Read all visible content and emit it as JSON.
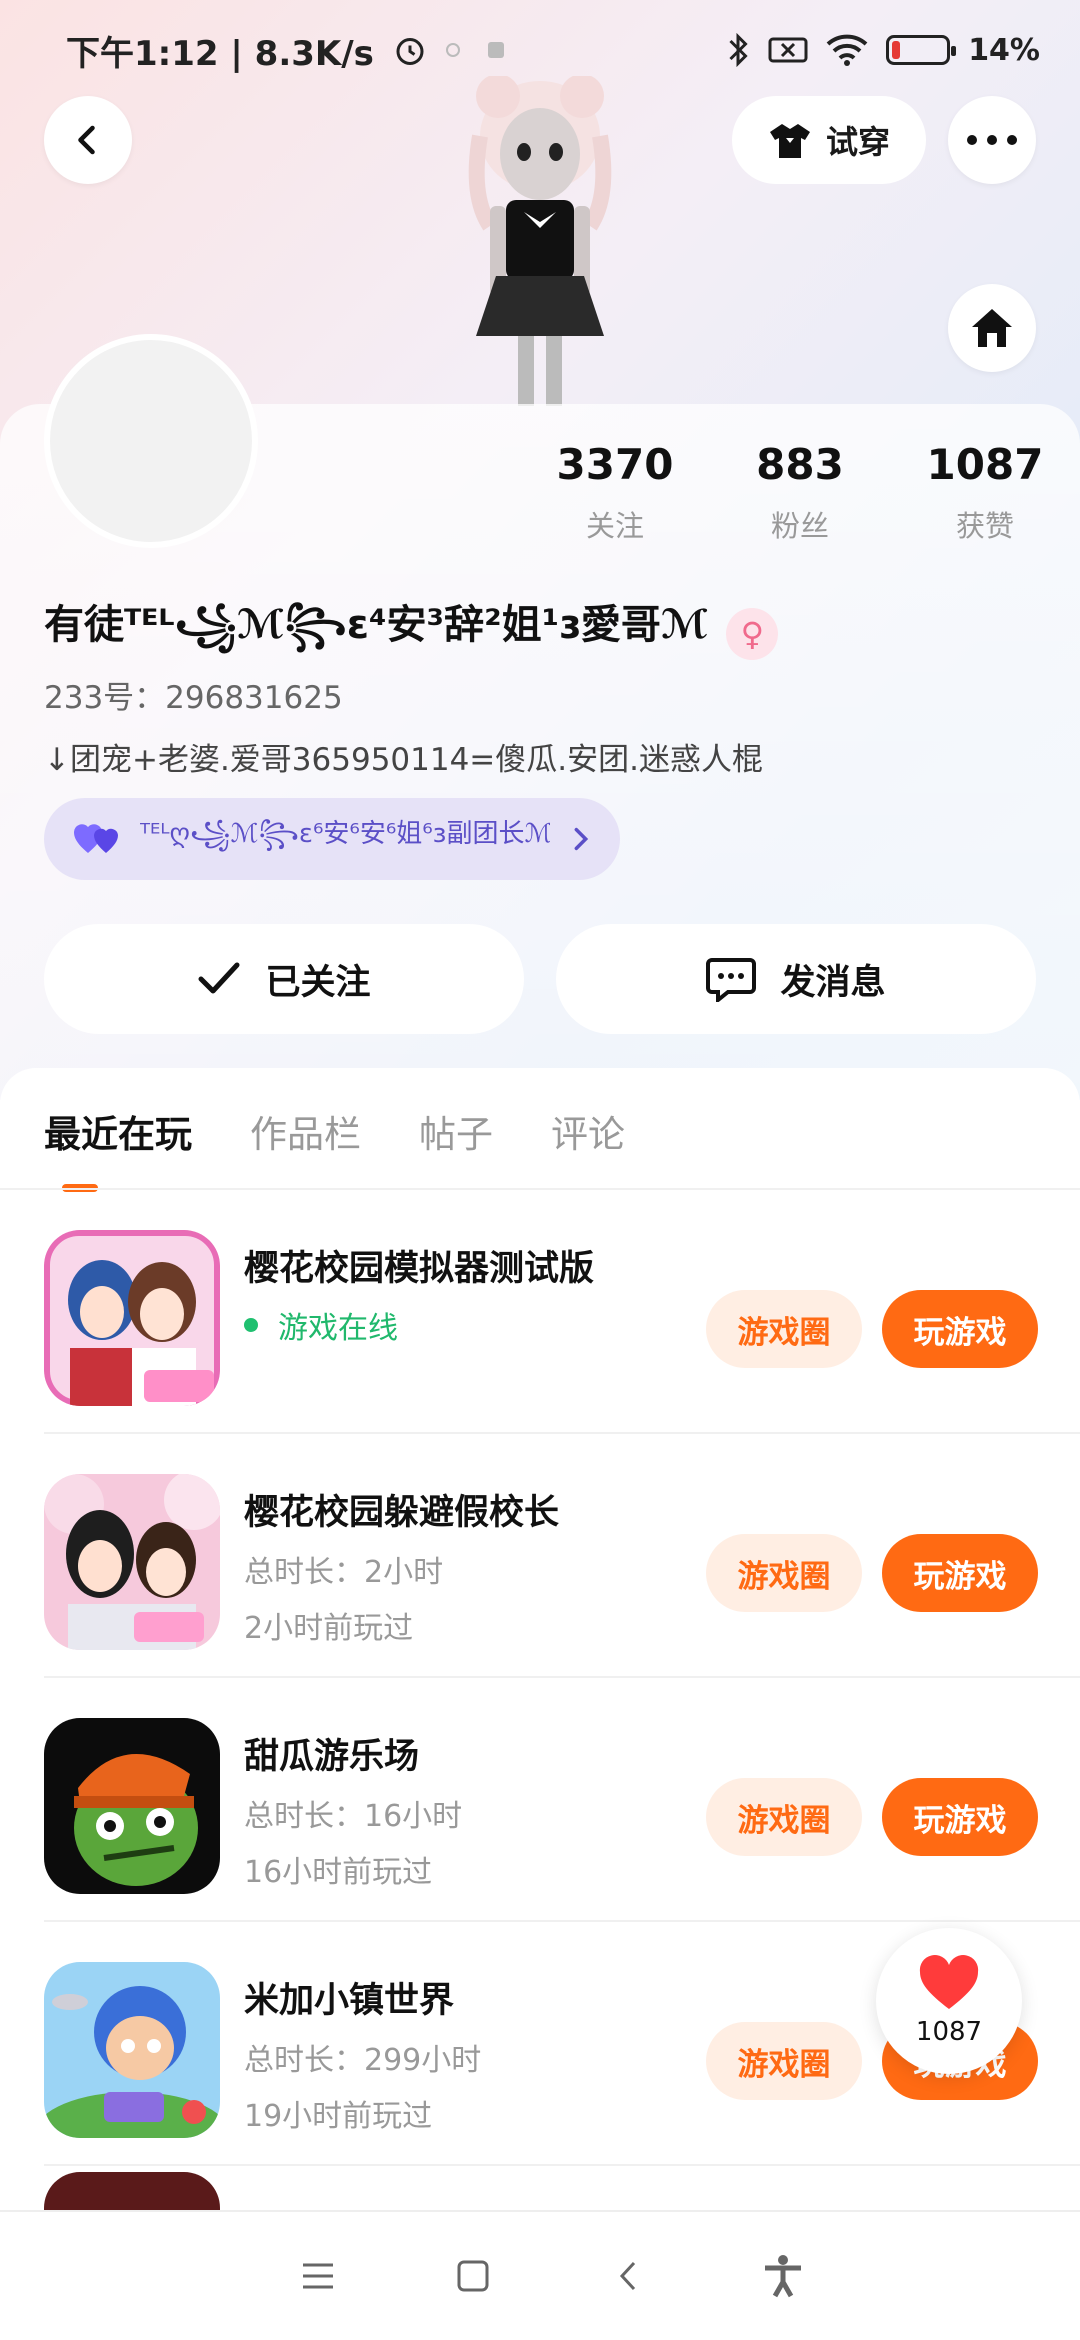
{
  "status_bar": {
    "time_speed": "下午1:12 | 8.3K/s",
    "battery": "14%",
    "battery_level": 0.14
  },
  "header": {
    "tryon_label": "试穿"
  },
  "stats": [
    {
      "num": "3370",
      "label": "关注"
    },
    {
      "num": "883",
      "label": "粉丝"
    },
    {
      "num": "1087",
      "label": "获赞"
    }
  ],
  "profile": {
    "nickname": "有徒ᵀᴱᴸ꧁ℳ꧂ɛ⁴安³辞²姐¹ɜ愛哥ℳ",
    "gender_symbol": "♀",
    "uid": "233号：296831625",
    "bio": "↓团宠+老婆.爱哥365950114=傻瓜.安团.迷惑人棍",
    "group_chip": "ᵀᴱᴸღ꧁ℳ꧂ɛ⁶安⁶安⁶姐⁶ɜ副团长ℳ"
  },
  "actions": {
    "follow_label": "已关注",
    "message_label": "发消息"
  },
  "tabs": [
    {
      "label": "最近在玩",
      "active": true
    },
    {
      "label": "作品栏",
      "active": false
    },
    {
      "label": "帖子",
      "active": false
    },
    {
      "label": "评论",
      "active": false
    }
  ],
  "games": [
    {
      "title": "樱花校园模拟器测试版",
      "status": "游戏在线",
      "circle": "游戏圈",
      "play": "玩游戏"
    },
    {
      "title": "樱花校园躲避假校长",
      "duration": "总时长：2小时",
      "last": "2小时前玩过",
      "circle": "游戏圈",
      "play": "玩游戏"
    },
    {
      "title": "甜瓜游乐场",
      "duration": "总时长：16小时",
      "last": "16小时前玩过",
      "circle": "游戏圈",
      "play": "玩游戏"
    },
    {
      "title": "米加小镇世界",
      "duration": "总时长：299小时",
      "last": "19小时前玩过",
      "circle": "游戏圈",
      "play": "玩游戏"
    }
  ],
  "like_float": {
    "count": "1087"
  },
  "colors": {
    "accent": "#ff6a13",
    "online": "#20b86c",
    "chip_bg": "#e6e2f7"
  }
}
